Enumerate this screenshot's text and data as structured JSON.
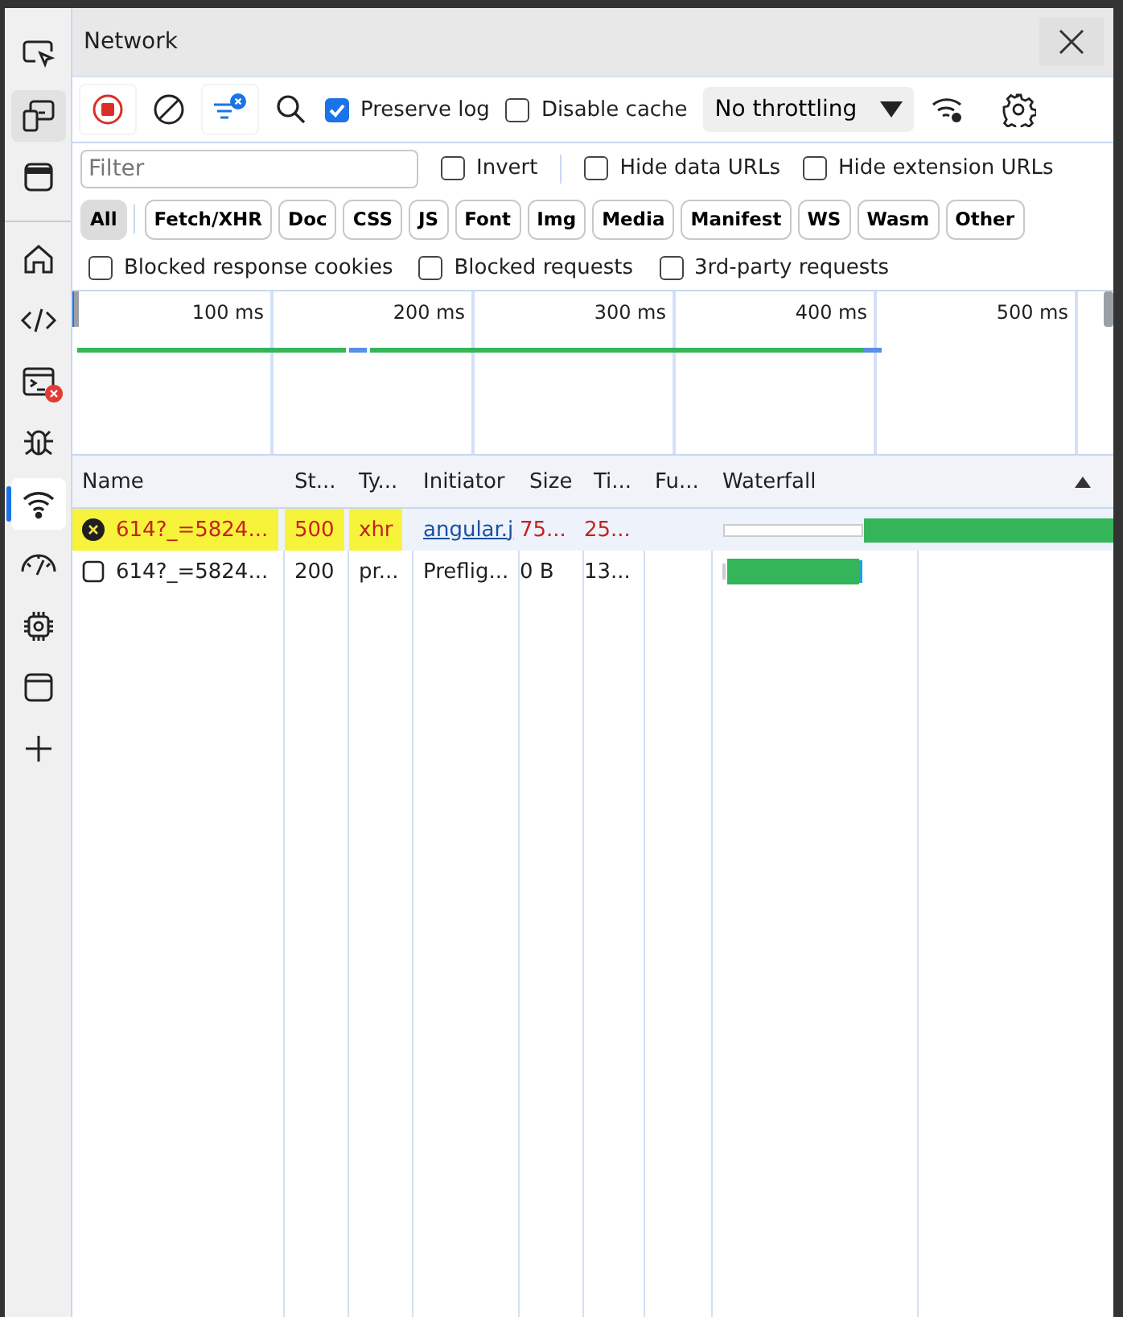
{
  "sidebar": {
    "items": [
      {
        "kind": "inspect",
        "selected": false
      },
      {
        "kind": "device",
        "selected": true
      },
      {
        "kind": "dock",
        "selected": false
      },
      {
        "kind": "home",
        "selected": false
      },
      {
        "kind": "elements",
        "selected": false
      },
      {
        "kind": "console",
        "selected": false,
        "error_badge": true
      },
      {
        "kind": "sources",
        "selected": false
      },
      {
        "kind": "network",
        "selected": true
      },
      {
        "kind": "performance",
        "selected": false
      },
      {
        "kind": "memory",
        "selected": false
      },
      {
        "kind": "application",
        "selected": false
      },
      {
        "kind": "more",
        "selected": false
      }
    ]
  },
  "panel": {
    "title": "Network"
  },
  "toolbar": {
    "recording": true,
    "filter_active": true,
    "preserve_log": {
      "label": "Preserve log",
      "checked": true
    },
    "disable_cache": {
      "label": "Disable cache",
      "checked": false
    },
    "throttling": "No throttling"
  },
  "filter_bar": {
    "placeholder": "Filter",
    "options": [
      {
        "label": "Invert",
        "checked": false
      },
      {
        "label": "Hide data URLs",
        "checked": false
      },
      {
        "label": "Hide extension URLs",
        "checked": false
      }
    ]
  },
  "type_filters": [
    {
      "label": "All",
      "selected": true
    },
    {
      "label": "Fetch/XHR",
      "selected": false
    },
    {
      "label": "Doc",
      "selected": false
    },
    {
      "label": "CSS",
      "selected": false
    },
    {
      "label": "JS",
      "selected": false
    },
    {
      "label": "Font",
      "selected": false
    },
    {
      "label": "Img",
      "selected": false
    },
    {
      "label": "Media",
      "selected": false
    },
    {
      "label": "Manifest",
      "selected": false
    },
    {
      "label": "WS",
      "selected": false
    },
    {
      "label": "Wasm",
      "selected": false
    },
    {
      "label": "Other",
      "selected": false
    }
  ],
  "blocked_filters": [
    {
      "label": "Blocked response cookies",
      "checked": false
    },
    {
      "label": "Blocked requests",
      "checked": false
    },
    {
      "label": "3rd-party requests",
      "checked": false
    }
  ],
  "overview": {
    "ticks": [
      "100 ms",
      "200 ms",
      "300 ms",
      "400 ms",
      "500 ms"
    ]
  },
  "table": {
    "columns": [
      "Name",
      "St...",
      "Ty...",
      "Initiator",
      "Size",
      "Ti...",
      "Fu...",
      "Waterfall"
    ],
    "sort_ascending": true,
    "rows": [
      {
        "name": "614?_=5824...",
        "status": "500",
        "type": "xhr",
        "initiator": "angular.j",
        "initiator_link": true,
        "size": "75...",
        "time": "25...",
        "error": true,
        "highlighted": true,
        "selected": true,
        "kind": "request"
      },
      {
        "name": "614?_=5824...",
        "status": "200",
        "type": "pr...",
        "initiator": "Preflig...",
        "initiator_link": false,
        "size": "0 B",
        "time": "13...",
        "error": false,
        "highlighted": false,
        "selected": false,
        "kind": "preflight"
      }
    ]
  }
}
